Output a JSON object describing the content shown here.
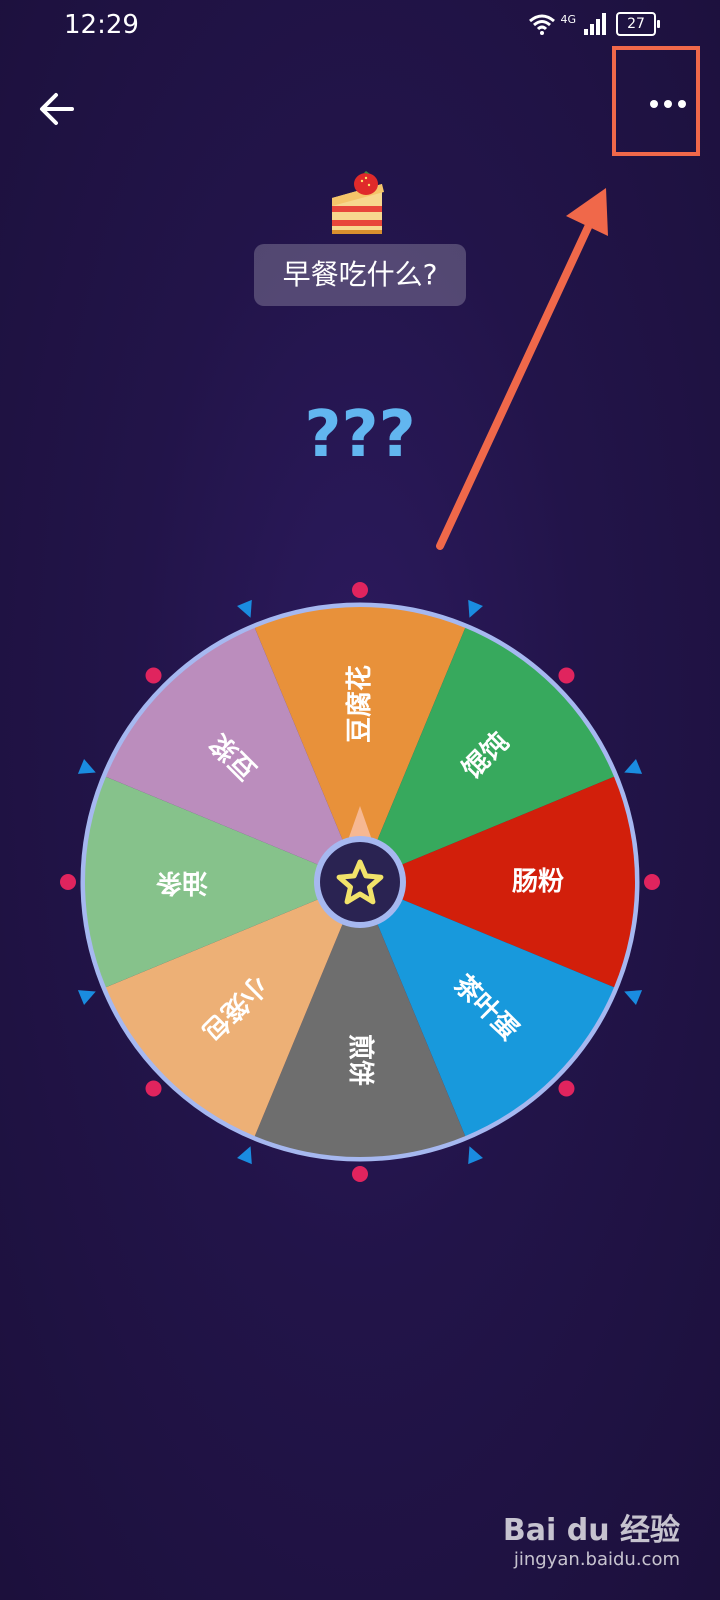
{
  "status_bar": {
    "time": "12:29",
    "network": "4G",
    "battery": "27"
  },
  "header": {
    "back_icon": "arrow-left-icon",
    "more_icon": "more-horizontal-icon"
  },
  "title": {
    "icon": "cake-emoji-icon",
    "text": "早餐吃什么?"
  },
  "result": {
    "text": "???"
  },
  "wheel": {
    "segments": [
      {
        "label": "豆腐花",
        "color": "#e8913a"
      },
      {
        "label": "馄饨",
        "color": "#37a95d"
      },
      {
        "label": "肠粉",
        "color": "#d21f0b"
      },
      {
        "label": "茶叶蛋",
        "color": "#1899dc"
      },
      {
        "label": "煎饼",
        "color": "#6e6e6e"
      },
      {
        "label": "小笼包",
        "color": "#edb076"
      },
      {
        "label": "油条",
        "color": "#86c28b"
      },
      {
        "label": "豆浆",
        "color": "#bb8dbd"
      }
    ],
    "center_icon": "star-icon",
    "pointer_icon": "pointer-triangle-icon",
    "rim_color": "#a6b8f0",
    "dot_color": "#e0245e",
    "marker_color": "#1a8ce0"
  },
  "annotation": {
    "color": "#f0684a"
  },
  "watermark": {
    "brand": "Bai du 经验",
    "url": "jingyan.baidu.com"
  }
}
